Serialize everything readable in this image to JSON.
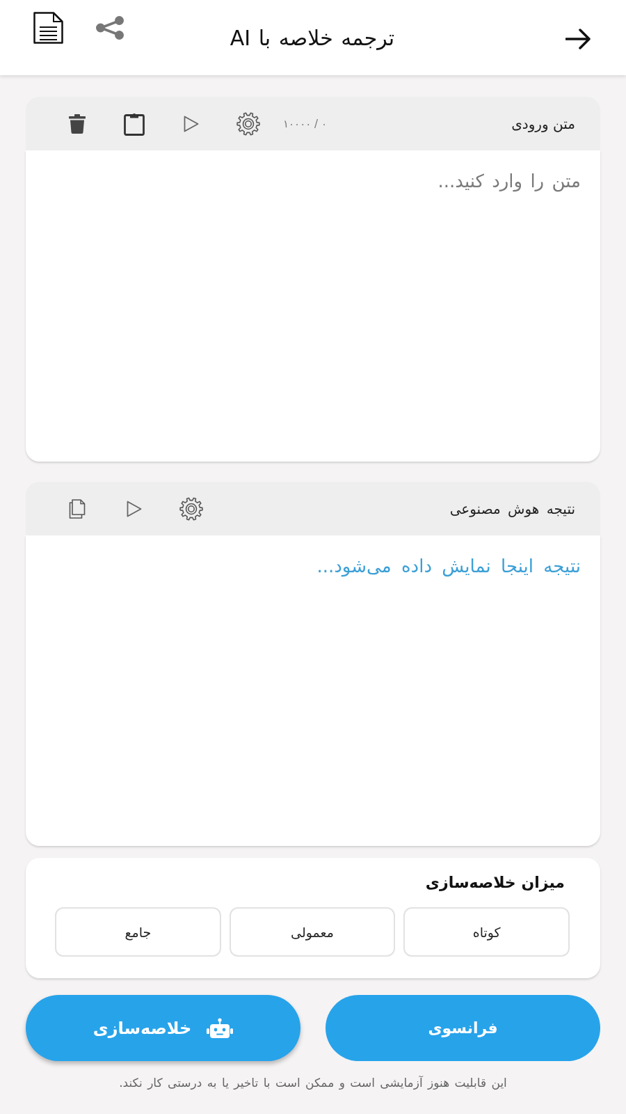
{
  "header": {
    "title": "ترجمه خلاصه با AI"
  },
  "input_panel": {
    "label": "متن ورودی",
    "counter": "۰ / ۱۰۰۰۰",
    "placeholder": "متن را وارد کنید..."
  },
  "output_panel": {
    "label": "نتیجه هوش مصنوعی",
    "placeholder": "نتیجه اینجا نمایش داده می‌شود..."
  },
  "summary_level": {
    "title": "میزان خلاصه‌سازی",
    "options": [
      {
        "label": "کوتاه",
        "selected": false
      },
      {
        "label": "معمولی",
        "selected": false
      },
      {
        "label": "جامع",
        "selected": false
      }
    ]
  },
  "actions": [
    {
      "label": "فرانسوی",
      "kind": "language"
    },
    {
      "label": "خلاصه‌سازی",
      "kind": "summarize"
    }
  ],
  "footer_note": "این قابلیت هنوز آزمایشی است و ممکن است با تاخیر یا به درستی کار نکند."
}
